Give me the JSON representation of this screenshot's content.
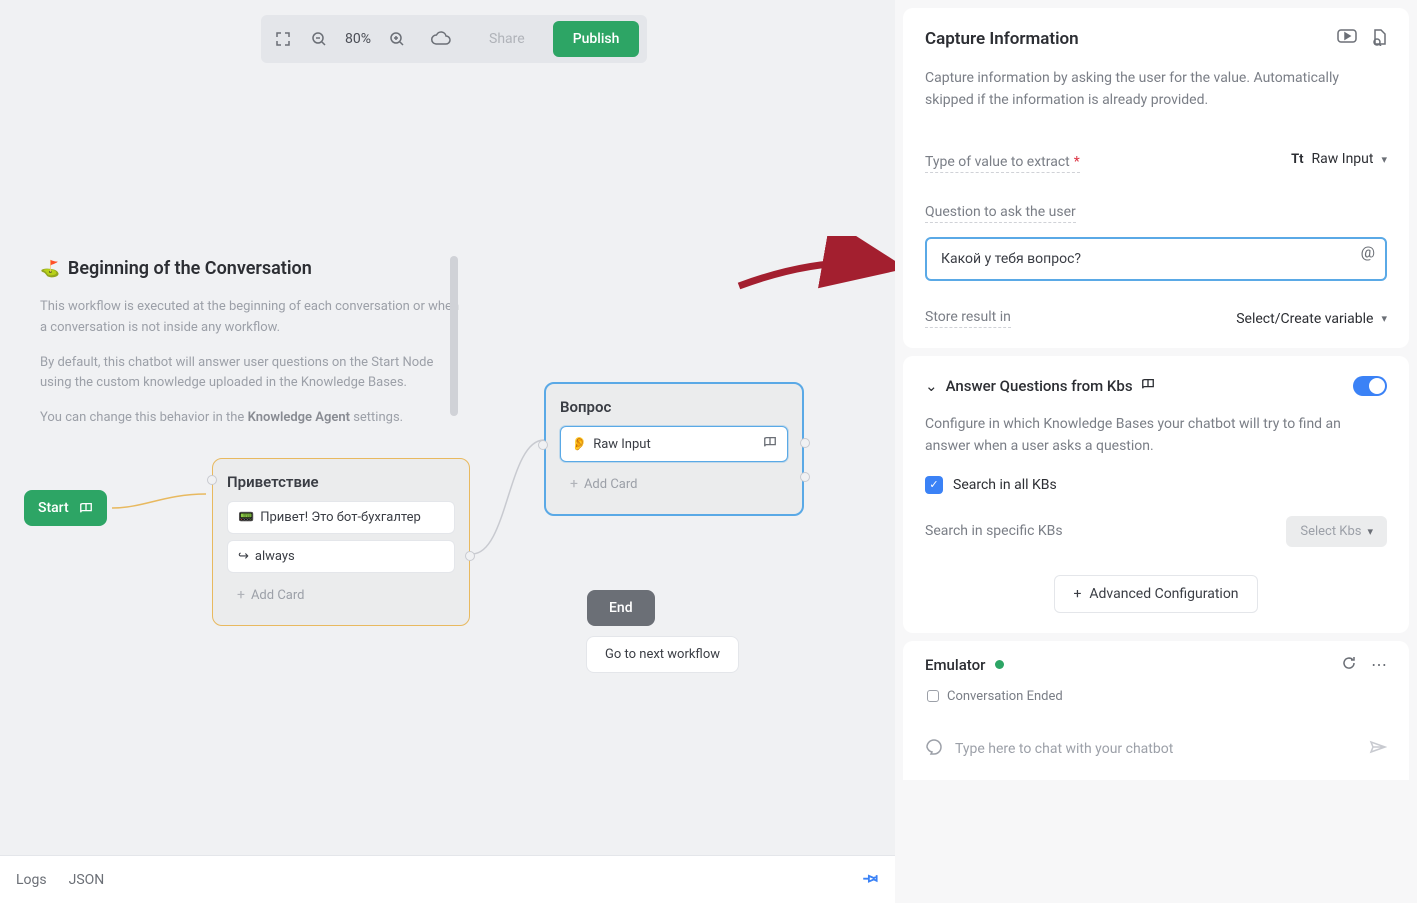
{
  "toolbar": {
    "zoom": "80%",
    "share": "Share",
    "publish": "Publish"
  },
  "info": {
    "title": "Beginning of the Conversation",
    "p1": "This workflow is executed at the beginning of each conversation or when a conversation is not inside any workflow.",
    "p2_a": "By default, this chatbot will answer user questions on the Start Node using the custom knowledge uploaded in the Knowledge Bases.",
    "p3_a": "You can change this behavior in the ",
    "p3_b": "Knowledge Agent",
    "p3_c": " settings."
  },
  "nodes": {
    "start": "Start",
    "greet": {
      "title": "Приветствие",
      "msg": "Привет! Это бот-бухгалтер",
      "cond": "always",
      "add": "Add Card"
    },
    "question": {
      "title": "Вопрос",
      "item": "Raw Input",
      "add": "Add Card"
    },
    "end": "End",
    "next": "Go to next workflow"
  },
  "bottom": {
    "logs": "Logs",
    "json": "JSON"
  },
  "right": {
    "title": "Capture Information",
    "desc": "Capture information by asking the user for the value. Automatically skipped if the information is already provided.",
    "typeLabel": "Type of value to extract",
    "typeValue": "Raw Input",
    "questionLabel": "Question to ask the user",
    "questionValue": "Какой у тебя вопрос?",
    "storeLabel": "Store result in",
    "storeValue": "Select/Create variable",
    "kb": {
      "title": "Answer Questions from Kbs",
      "desc": "Configure in which Knowledge Bases your chatbot will try to find an answer when a user asks a question.",
      "searchAll": "Search in all KBs",
      "specific": "Search in specific KBs",
      "selectBtn": "Select Kbs",
      "advanced": "Advanced Configuration"
    },
    "emu": {
      "title": "Emulator",
      "ended": "Conversation Ended",
      "placeholder": "Type here to chat with your chatbot"
    }
  }
}
